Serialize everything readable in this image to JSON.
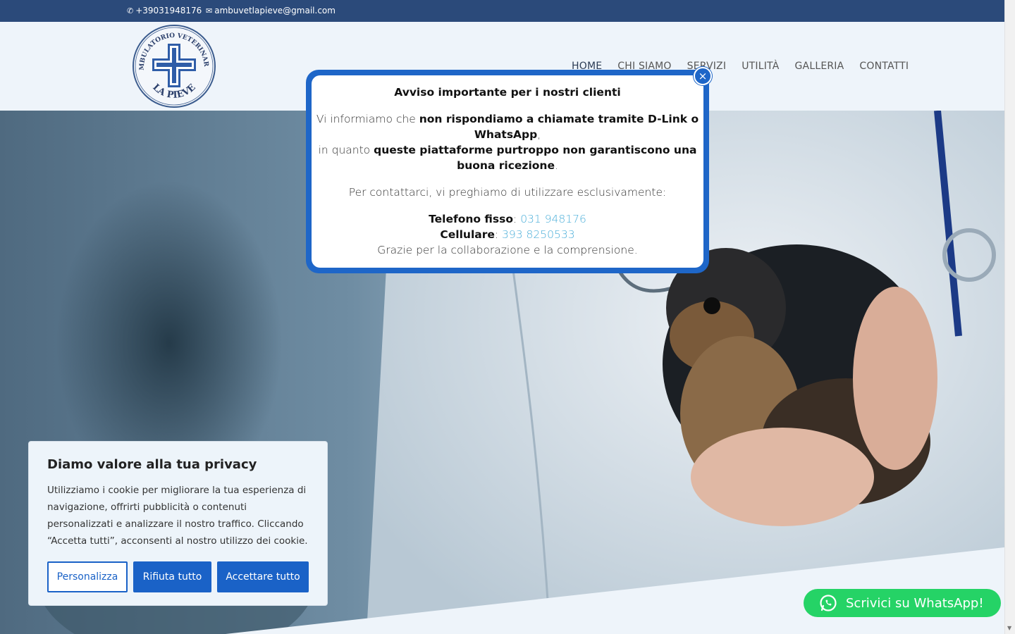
{
  "topbar": {
    "phone": "+39031948176",
    "email": "ambuvetlapieve@gmail.com",
    "phone_icon": "phone-icon",
    "email_icon": "mail-icon"
  },
  "logo": {
    "top_text": "AMBULATORIO VETERINARIO",
    "bottom_text": "LA PIEVE"
  },
  "nav": {
    "items": [
      "HOME",
      "CHI SIAMO",
      "SERVIZI",
      "UTILITÀ",
      "GALLERIA",
      "CONTATTI"
    ]
  },
  "modal": {
    "title_icon": "",
    "title": "Avviso importante per i nostri clienti",
    "p1_a": "Vi informiamo che ",
    "p1_b": "non rispondiamo a chiamate tramite D-Link o WhatsApp",
    "p1_c": ",",
    "p1_d": "in quanto ",
    "p1_e": "queste piattaforme purtroppo non garantiscono una buona ricezione",
    "p1_f": ".",
    "p2_icon": "",
    "p2": "Per contattarci, vi preghiamo di utilizzare esclusivamente:",
    "landline_label": "Telefono fisso",
    "landline_value": "031 948176",
    "mobile_label": "Cellulare",
    "mobile_value": "393 8250533",
    "thanks": "Grazie per la collaborazione e la comprensione.",
    "close_glyph": "×"
  },
  "cookie": {
    "title": "Diamo valore alla tua privacy",
    "text": "Utilizziamo i cookie per migliorare la tua esperienza di navigazione, offrirti pubblicità o contenuti personalizzati e analizzare il nostro traffico. Cliccando “Accetta tutti”, acconsenti al nostro utilizzo dei cookie.",
    "customize": "Personalizza",
    "reject": "Rifiuta tutto",
    "accept": "Accettare tutto"
  },
  "whatsapp": {
    "label": "Scrivici su WhatsApp!"
  },
  "colors": {
    "topbar": "#2b4a7a",
    "accent": "#1e66c8",
    "link": "#4aaed9",
    "whatsapp": "#25d366"
  }
}
